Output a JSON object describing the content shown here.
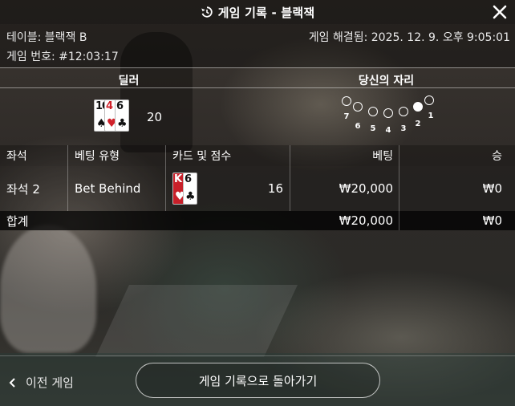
{
  "header": {
    "title": "게임 기록 - 블랙잭"
  },
  "meta": {
    "table": "테이블: 블랙잭 B",
    "game_number": "게임 번호: #12:03:17",
    "resolved": "게임 해결됨: 2025. 12. 9. 오후 9:05:01"
  },
  "dealer": {
    "heading": "딜러",
    "cards": [
      {
        "rank": "10",
        "suit": "♠",
        "color": "black"
      },
      {
        "rank": "4",
        "suit": "♥",
        "color": "red"
      },
      {
        "rank": "6",
        "suit": "♣",
        "color": "black"
      }
    ],
    "score": "20"
  },
  "seat_map": {
    "heading": "당신의 자리",
    "seats": [
      "7",
      "6",
      "5",
      "4",
      "3",
      "2",
      "1"
    ],
    "active_seat": "2"
  },
  "table": {
    "columns": [
      "좌석",
      "베팅 유형",
      "카드 및 점수",
      "베팅",
      "승"
    ],
    "rows": [
      {
        "seat": "좌석 2",
        "bet_type": "Bet Behind",
        "cards": [
          {
            "rank": "K",
            "suit": "♥",
            "color": "red"
          },
          {
            "rank": "6",
            "suit": "♣",
            "color": "black"
          }
        ],
        "score": "16",
        "bet": "₩20,000",
        "win": "₩0"
      }
    ],
    "total": {
      "label": "합계",
      "bet": "₩20,000",
      "win": "₩0"
    }
  },
  "footer": {
    "prev_game": "이전 게임",
    "back_button": "게임 기록으로 돌아가기"
  },
  "icons": {
    "history": "history-icon",
    "close": "close-icon",
    "prev": "chevron-left-icon"
  },
  "colors": {
    "card_red": "#d0212a",
    "card_black": "#111111"
  }
}
